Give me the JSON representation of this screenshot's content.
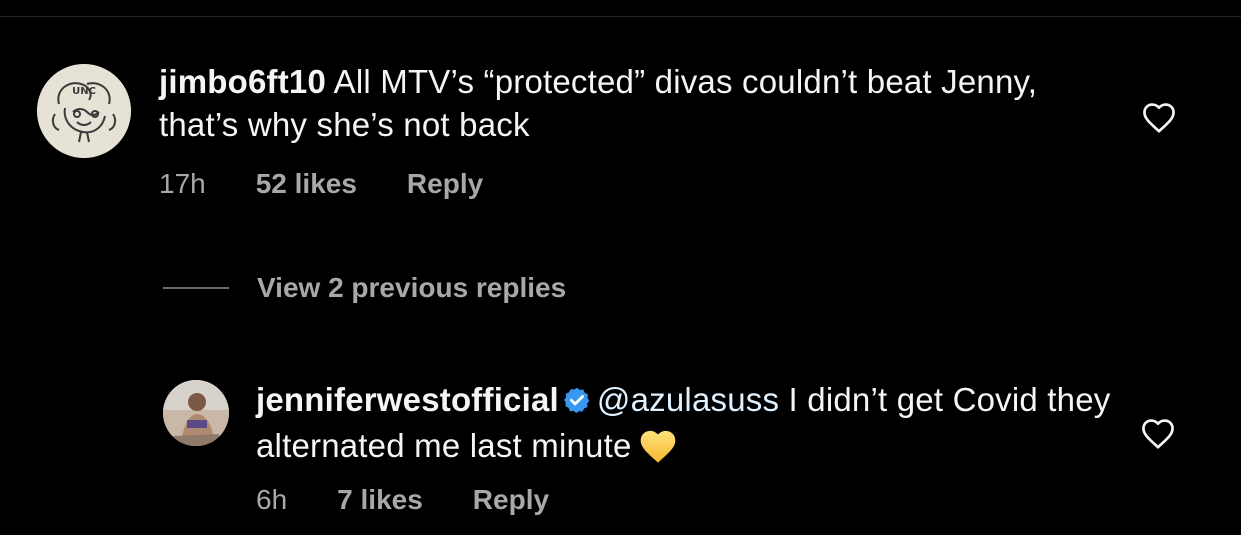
{
  "comments": [
    {
      "username": "jimbo6ft10",
      "text": "All MTV’s “protected” divas couldn’t beat Jenny, that’s why she’s not back",
      "time": "17h",
      "likes": "52 likes",
      "reply_label": "Reply",
      "avatar_badge_text": "UNC",
      "verified": false
    },
    {
      "username": "jenniferwestofficial",
      "mention": "@azulasuss",
      "text": "I didn’t get Covid they alternated me last minute",
      "emoji": "yellow-heart",
      "time": "6h",
      "likes": "7 likes",
      "reply_label": "Reply",
      "verified": true
    }
  ],
  "view_replies": {
    "label": "View 2 previous replies"
  },
  "colors": {
    "background": "#000000",
    "primary_text": "#f5f5f5",
    "secondary_text": "#a8a8a8",
    "verified_blue": "#3897f0",
    "mention": "#e0f1ff",
    "emoji_yellow": "#ffd25a"
  },
  "icons": {
    "like": "heart-outline-icon",
    "verified": "verified-badge-icon",
    "emoji": "yellow-heart-emoji"
  }
}
